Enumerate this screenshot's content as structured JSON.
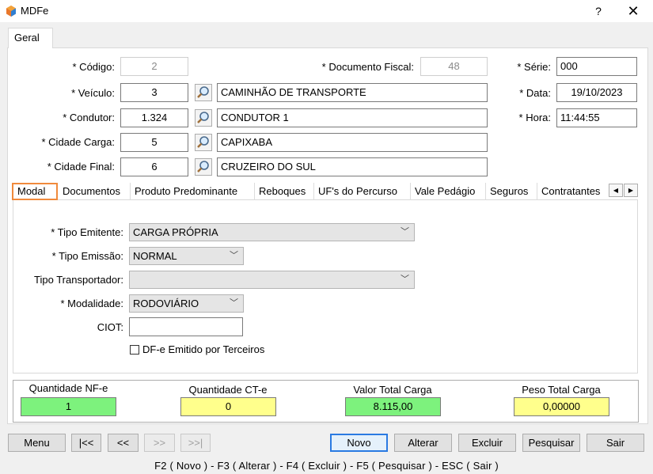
{
  "window": {
    "title": "MDFe",
    "help": "?",
    "close": "✕"
  },
  "tabs": {
    "main": "Geral"
  },
  "form": {
    "codigo_label": "* Código:",
    "codigo_value": "2",
    "doc_fiscal_label": "* Documento Fiscal:",
    "doc_fiscal_value": "48",
    "serie_label": "* Série:",
    "serie_value": "000",
    "veiculo_label": "* Veículo:",
    "veiculo_code": "3",
    "veiculo_name": "CAMINHÃO DE TRANSPORTE",
    "data_label": "* Data:",
    "data_value": "19/10/2023",
    "condutor_label": "* Condutor:",
    "condutor_code": "1.324",
    "condutor_name": "CONDUTOR 1",
    "hora_label": "* Hora:",
    "hora_value": "11:44:55",
    "cidade_carga_label": "* Cidade Carga:",
    "cidade_carga_code": "5",
    "cidade_carga_name": "CAPIXABA",
    "cidade_final_label": "* Cidade Final:",
    "cidade_final_code": "6",
    "cidade_final_name": "CRUZEIRO DO SUL"
  },
  "inner_tabs": [
    "Modal",
    "Documentos",
    "Produto Predominante",
    "Reboques",
    "UF's do Percurso",
    "Vale Pedágio",
    "Seguros",
    "Contratantes"
  ],
  "modal": {
    "tipo_emitente_label": "* Tipo Emitente:",
    "tipo_emitente_value": "CARGA PRÓPRIA",
    "tipo_emissao_label": "* Tipo Emissão:",
    "tipo_emissao_value": "NORMAL",
    "tipo_transportador_label": "Tipo Transportador:",
    "tipo_transportador_value": "",
    "modalidade_label": "* Modalidade:",
    "modalidade_value": "RODOVIÁRIO",
    "ciot_label": "CIOT:",
    "ciot_value": "",
    "dfe_terceiros_label": "DF-e Emitido por Terceiros"
  },
  "totals": {
    "qtd_nfe_label": "Quantidade NF-e",
    "qtd_nfe_value": "1",
    "qtd_cte_label": "Quantidade CT-e",
    "qtd_cte_value": "0",
    "valor_total_label": "Valor Total Carga",
    "valor_total_value": "8.115,00",
    "peso_total_label": "Peso Total Carga",
    "peso_total_value": "0,00000"
  },
  "buttons": {
    "menu": "Menu",
    "first": "|<<",
    "prev": "<<",
    "next": ">>",
    "last": ">>|",
    "novo": "Novo",
    "alterar": "Alterar",
    "excluir": "Excluir",
    "pesquisar": "Pesquisar",
    "sair": "Sair"
  },
  "shortcuts": "F2 ( Novo )  -  F3 ( Alterar )  -  F4 ( Excluir )  -  F5 ( Pesquisar )  -  ESC ( Sair )",
  "colors": {
    "green": "#7df27d",
    "yellow": "#ffff8c",
    "active_tab_outline": "#f08a3c"
  }
}
